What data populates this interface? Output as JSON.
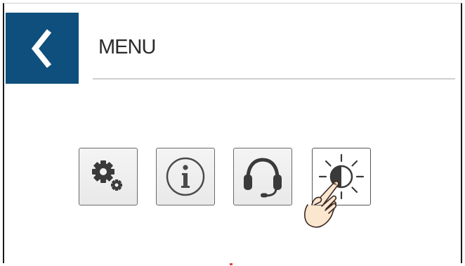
{
  "header": {
    "title": "MENU",
    "back_icon": "chevron-left-icon",
    "back_color": "#0e4f7d"
  },
  "menu": {
    "items": [
      {
        "name": "settings",
        "icon": "gear-icon"
      },
      {
        "name": "info",
        "icon": "info-icon"
      },
      {
        "name": "support",
        "icon": "headset-icon"
      },
      {
        "name": "brightness",
        "icon": "brightness-icon",
        "active": true
      }
    ]
  },
  "pointer": {
    "icon": "pointing-hand-icon"
  }
}
